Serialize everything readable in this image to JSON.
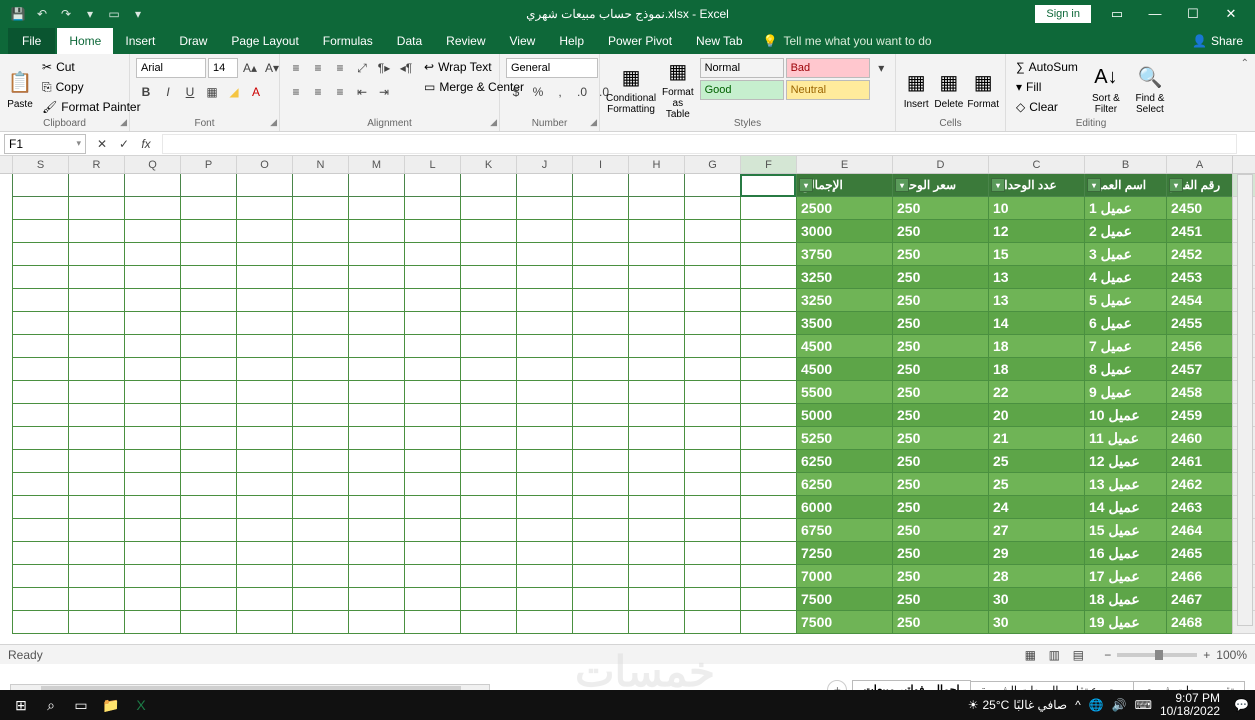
{
  "title": "نموذج حساب مبيعات شهري.xlsx - Excel",
  "signin": "Sign in",
  "tabs": {
    "file": "File",
    "home": "Home",
    "insert": "Insert",
    "draw": "Draw",
    "pagelayout": "Page Layout",
    "formulas": "Formulas",
    "data": "Data",
    "review": "Review",
    "view": "View",
    "help": "Help",
    "powerpivot": "Power Pivot",
    "newtab": "New Tab",
    "tellme": "Tell me what you want to do",
    "share": "Share"
  },
  "ribbon": {
    "clipboard": {
      "label": "Clipboard",
      "paste": "Paste",
      "cut": "Cut",
      "copy": "Copy",
      "painter": "Format Painter"
    },
    "font": {
      "label": "Font",
      "name": "Arial",
      "size": "14"
    },
    "alignment": {
      "label": "Alignment",
      "wrap": "Wrap Text",
      "merge": "Merge & Center"
    },
    "number": {
      "label": "Number",
      "format": "General"
    },
    "styles": {
      "label": "Styles",
      "cond": "Conditional Formatting",
      "fat": "Format as Table",
      "normal": "Normal",
      "bad": "Bad",
      "good": "Good",
      "neutral": "Neutral"
    },
    "cells": {
      "label": "Cells",
      "insert": "Insert",
      "delete": "Delete",
      "format": "Format"
    },
    "editing": {
      "label": "Editing",
      "autosum": "AutoSum",
      "fill": "Fill",
      "clear": "Clear",
      "sort": "Sort & Filter",
      "find": "Find & Select"
    }
  },
  "namebox": "F1",
  "columns": [
    "A",
    "B",
    "C",
    "D",
    "E",
    "F",
    "G",
    "H",
    "I",
    "J",
    "K",
    "L",
    "M",
    "N",
    "O",
    "P",
    "Q",
    "R",
    "S"
  ],
  "colwidths": {
    "A": 66,
    "B": 82,
    "C": 96,
    "D": 96,
    "E": 96,
    "F": 56,
    "other": 56
  },
  "headers": [
    "رقم الفاتو",
    "اسم العميل",
    "عدد الوحدات",
    "سعر الوحدة",
    "الإجمالي"
  ],
  "rows": [
    {
      "a": "2450",
      "b": "عميل 1",
      "c": "10",
      "d": "250",
      "e": "2500"
    },
    {
      "a": "2451",
      "b": "عميل 2",
      "c": "12",
      "d": "250",
      "e": "3000"
    },
    {
      "a": "2452",
      "b": "عميل 3",
      "c": "15",
      "d": "250",
      "e": "3750"
    },
    {
      "a": "2453",
      "b": "عميل 4",
      "c": "13",
      "d": "250",
      "e": "3250"
    },
    {
      "a": "2454",
      "b": "عميل 5",
      "c": "13",
      "d": "250",
      "e": "3250"
    },
    {
      "a": "2455",
      "b": "عميل 6",
      "c": "14",
      "d": "250",
      "e": "3500"
    },
    {
      "a": "2456",
      "b": "عميل 7",
      "c": "18",
      "d": "250",
      "e": "4500"
    },
    {
      "a": "2457",
      "b": "عميل 8",
      "c": "18",
      "d": "250",
      "e": "4500"
    },
    {
      "a": "2458",
      "b": "عميل 9",
      "c": "22",
      "d": "250",
      "e": "5500"
    },
    {
      "a": "2459",
      "b": "عميل 10",
      "c": "20",
      "d": "250",
      "e": "5000"
    },
    {
      "a": "2460",
      "b": "عميل 11",
      "c": "21",
      "d": "250",
      "e": "5250"
    },
    {
      "a": "2461",
      "b": "عميل 12",
      "c": "25",
      "d": "250",
      "e": "6250"
    },
    {
      "a": "2462",
      "b": "عميل 13",
      "c": "25",
      "d": "250",
      "e": "6250"
    },
    {
      "a": "2463",
      "b": "عميل 14",
      "c": "24",
      "d": "250",
      "e": "6000"
    },
    {
      "a": "2464",
      "b": "عميل 15",
      "c": "27",
      "d": "250",
      "e": "6750"
    },
    {
      "a": "2465",
      "b": "عميل 16",
      "c": "29",
      "d": "250",
      "e": "7250"
    },
    {
      "a": "2466",
      "b": "عميل 17",
      "c": "28",
      "d": "250",
      "e": "7000"
    },
    {
      "a": "2467",
      "b": "عميل 18",
      "c": "30",
      "d": "250",
      "e": "7500"
    },
    {
      "a": "2468",
      "b": "عميل 19",
      "c": "30",
      "d": "250",
      "e": "7500"
    }
  ],
  "sheets": {
    "s1": "تقرير مبيعات شهري",
    "s2": "مجموع تقارير المبيعات الشهرية",
    "s3": "اجمالي فواتير مبيعات"
  },
  "status": {
    "ready": "Ready",
    "zoom": "100%"
  },
  "taskbar": {
    "weather": "25°C",
    "weather_txt": "صافي غالبًا",
    "time": "9:07 PM",
    "date": "10/18/2022"
  },
  "watermark": "خمسات"
}
